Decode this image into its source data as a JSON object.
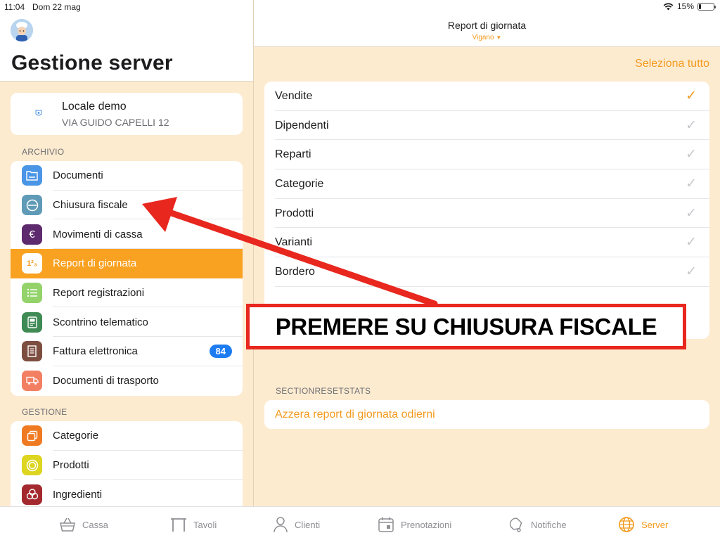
{
  "status": {
    "time": "11:04",
    "date": "Dom 22 mag",
    "battery": "15%",
    "battery_level": 0.15
  },
  "sidebar": {
    "title": "Gestione server",
    "venue": {
      "name": "Locale demo",
      "address": "VIA GUIDO CAPELLI 12"
    },
    "archive_label": "ARCHIVIO",
    "archive_items": [
      {
        "label": "Documenti",
        "icon": "folder-icon",
        "color": "#4a95e6"
      },
      {
        "label": "Chiusura fiscale",
        "icon": "minus-circle-icon",
        "color": "#5f9ab6"
      },
      {
        "label": "Movimenti di cassa",
        "icon": "euro-icon",
        "color": "#5e2a6e"
      },
      {
        "label": "Report di giornata",
        "icon": "numbers-icon",
        "color": "#ffffff",
        "active": true
      },
      {
        "label": "Report registrazioni",
        "icon": "list-icon",
        "color": "#93d36a"
      },
      {
        "label": "Scontrino telematico",
        "icon": "receipt-icon",
        "color": "#3f8a55"
      },
      {
        "label": "Fattura elettronica",
        "icon": "invoice-icon",
        "color": "#7d4e40",
        "badge": "84"
      },
      {
        "label": "Documenti di trasporto",
        "icon": "truck-icon",
        "color": "#f37f62"
      }
    ],
    "manage_label": "GESTIONE",
    "manage_items": [
      {
        "label": "Categorie",
        "icon": "categories-icon",
        "color": "#f07a22"
      },
      {
        "label": "Prodotti",
        "icon": "product-ring-icon",
        "color": "#ddd51f"
      },
      {
        "label": "Ingredienti",
        "icon": "ingredients-icon",
        "color": "#a3292f"
      }
    ]
  },
  "main": {
    "title": "Report di giornata",
    "subtitle": "Vigano",
    "select_all": "Seleziona tutto",
    "reports": [
      {
        "label": "Vendite",
        "checked": true
      },
      {
        "label": "Dipendenti",
        "checked": false
      },
      {
        "label": "Reparti",
        "checked": false
      },
      {
        "label": "Categorie",
        "checked": false
      },
      {
        "label": "Prodotti",
        "checked": false
      },
      {
        "label": "Varianti",
        "checked": false
      },
      {
        "label": "Bordero",
        "checked": false
      }
    ],
    "checkmark": "✓",
    "reset_section": "SECTIONRESETSTATS",
    "reset_action": "Azzera report di giornata odierni"
  },
  "tabs": [
    {
      "label": "Cassa",
      "icon": "basket-icon"
    },
    {
      "label": "Tavoli",
      "icon": "table-icon"
    },
    {
      "label": "Clienti",
      "icon": "person-icon"
    },
    {
      "label": "Prenotazioni",
      "icon": "calendar-icon"
    },
    {
      "label": "Notifiche",
      "icon": "bell-icon"
    },
    {
      "label": "Server",
      "icon": "globe-icon",
      "active": true
    }
  ],
  "annotation": {
    "text": "PREMERE SU CHIUSURA FISCALE",
    "color": "#e8271e"
  }
}
